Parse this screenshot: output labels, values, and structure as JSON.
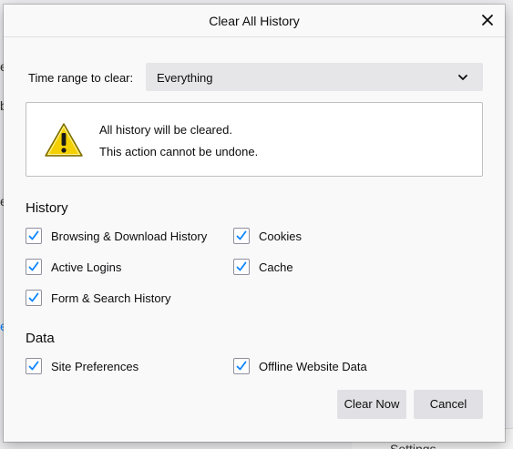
{
  "background": {
    "fragments": [
      "e",
      "b",
      "e",
      "e"
    ],
    "settings_label": "Settings"
  },
  "dialog": {
    "title": "Clear All History",
    "close_icon": "close-icon",
    "time_range": {
      "label": "Time range to clear:",
      "selected": "Everything"
    },
    "warning": {
      "icon": "warning-icon",
      "line1": "All history will be cleared.",
      "line2": "This action cannot be undone."
    },
    "history": {
      "heading": "History",
      "items": [
        {
          "label": "Browsing & Download History",
          "checked": true
        },
        {
          "label": "Cookies",
          "checked": true
        },
        {
          "label": "Active Logins",
          "checked": true
        },
        {
          "label": "Cache",
          "checked": true
        },
        {
          "label": "Form & Search History",
          "checked": true
        }
      ]
    },
    "data": {
      "heading": "Data",
      "items": [
        {
          "label": "Site Preferences",
          "checked": true
        },
        {
          "label": "Offline Website Data",
          "checked": true
        }
      ]
    },
    "buttons": {
      "clear_now": "Clear Now",
      "cancel": "Cancel"
    }
  },
  "colors": {
    "checkmark": "#0a84ff",
    "dialog_bg": "#f9f9fa",
    "button_bg": "#e1e1e5",
    "warning_yellow": "#f5d000"
  }
}
